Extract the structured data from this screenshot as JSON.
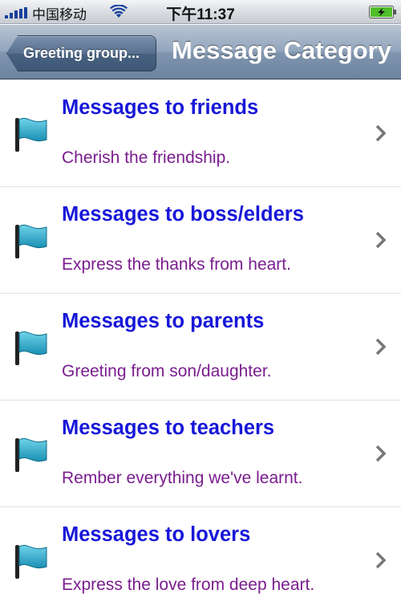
{
  "status_bar": {
    "carrier": "中国移动",
    "time": "下午11:37"
  },
  "nav_bar": {
    "back_label": "Greeting group...",
    "title": "Message Category"
  },
  "categories": [
    {
      "title": "Messages to friends",
      "subtitle": "Cherish the friendship."
    },
    {
      "title": "Messages to boss/elders",
      "subtitle": "Express the thanks from heart."
    },
    {
      "title": "Messages to parents",
      "subtitle": "Greeting from son/daughter."
    },
    {
      "title": "Messages to teachers",
      "subtitle": "Rember everything we've learnt."
    },
    {
      "title": "Messages to lovers",
      "subtitle": "Express the love from deep heart."
    }
  ],
  "icons": {
    "row_icon": "flag-icon",
    "disclosure": "chevron-right-icon"
  },
  "colors": {
    "title": "#1717d9",
    "subtitle": "#7a1d8e",
    "nav": "#7a8fab",
    "flag": "#2aa8c8"
  }
}
